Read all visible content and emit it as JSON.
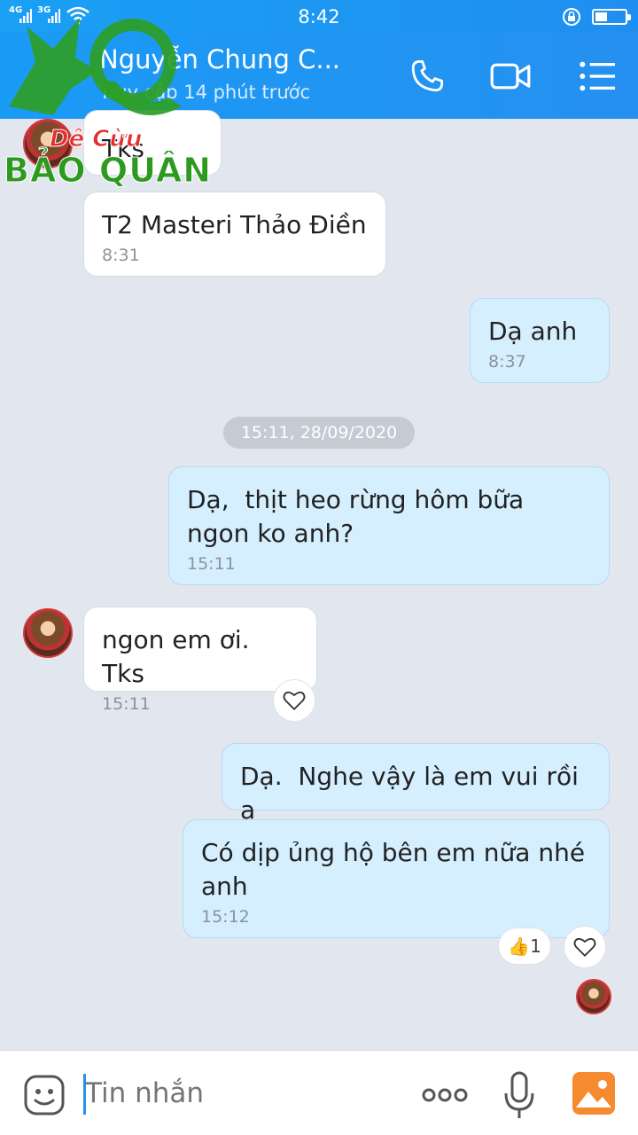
{
  "status_bar": {
    "time": "8:42",
    "network1": "4G",
    "network2": "3G"
  },
  "header": {
    "title": "Nguyễn Chung C...",
    "subtitle": "Truy cập 14 phút trước",
    "icons": [
      "phone-icon",
      "video-call-icon",
      "menu-icon"
    ]
  },
  "logo": {
    "line1": "Dê Cừu",
    "line2": "BẢO QUÂN"
  },
  "messages": [
    {
      "side": "in",
      "text": "Tks",
      "time": ""
    },
    {
      "side": "in",
      "text": "T2 Masteri Thảo Điền",
      "time": "8:31"
    },
    {
      "side": "out",
      "text": "Dạ anh",
      "time": "8:37"
    },
    {
      "side": "out",
      "text": "Dạ,  thịt heo rừng hôm bữa ngon ko anh?",
      "time": "15:11"
    },
    {
      "side": "in",
      "text": "ngon em ơi. Tks",
      "time": "15:11"
    },
    {
      "side": "out",
      "text": "Dạ.  Nghe vậy là em vui rồi ạ",
      "time": ""
    },
    {
      "side": "out",
      "text": "Có dịp ủng hộ bên em nữa nhé anh",
      "time": "15:12"
    }
  ],
  "date_divider": "15:11, 28/09/2020",
  "reactions": {
    "like_count": "1"
  },
  "input_bar": {
    "placeholder": "Tin nhắn"
  },
  "colors": {
    "header": "#1a9bf6",
    "outgoing_bubble": "#d5efff",
    "incoming_bubble": "#ffffff",
    "background": "#e2e7ef"
  }
}
